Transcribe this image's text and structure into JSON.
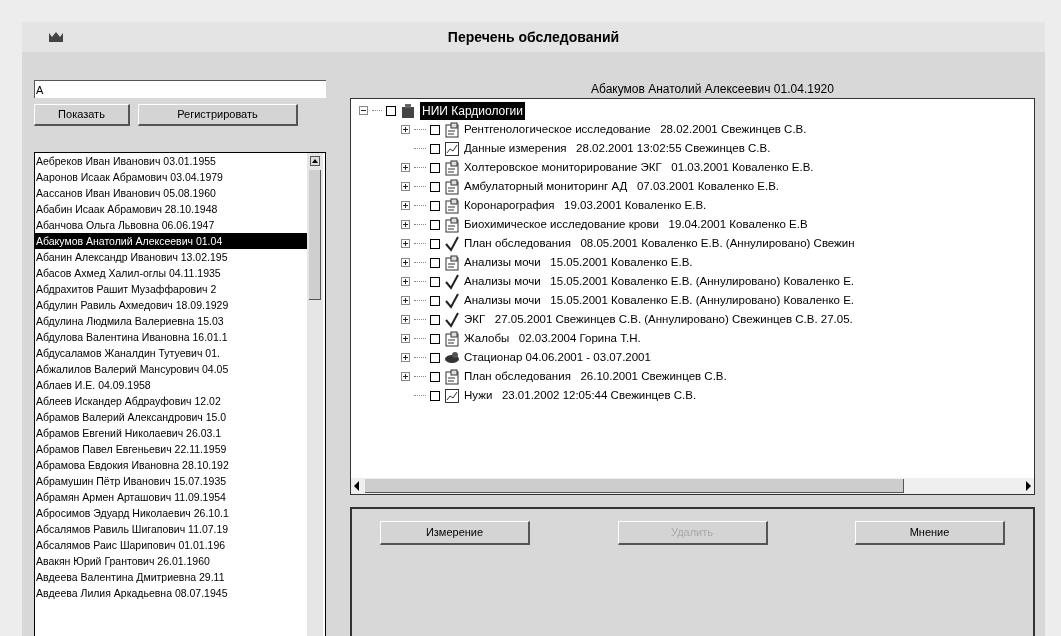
{
  "window": {
    "title": "Перечень обследований"
  },
  "search": {
    "value": "А"
  },
  "actions": [
    {
      "label": "Показать"
    },
    {
      "label": "Регистрировать"
    }
  ],
  "patients": [
    {
      "name": "Аебреков Иван Иванович 03.01.1955",
      "selected": false
    },
    {
      "name": "Ааронов Исаак Абрамович 03.04.1979",
      "selected": false
    },
    {
      "name": "Аассанов Иван Иванович 05.08.1960",
      "selected": false
    },
    {
      "name": "Абабин Исаак Абрамович 28.10.1948",
      "selected": false
    },
    {
      "name": "Абанчова Ольга Львовна 06.06.1947",
      "selected": false
    },
    {
      "name": "Абакумов Анатолий Алексеевич 01.04",
      "selected": true
    },
    {
      "name": "Абанин Александр Иванович 13.02.195",
      "selected": false
    },
    {
      "name": "Абасов Ахмед Халил-оглы 04.11.1935",
      "selected": false
    },
    {
      "name": "Абдрахитов Рашит Музаффарович 2",
      "selected": false
    },
    {
      "name": "Абдулин Равиль Ахмедович 18.09.1929",
      "selected": false
    },
    {
      "name": "Абдулина Людмила Валериевна 15.03",
      "selected": false
    },
    {
      "name": "Абдулова Валентина Ивановна 16.01.1",
      "selected": false
    },
    {
      "name": "Абдусаламов Жаналдин Тутуевич 01.",
      "selected": false
    },
    {
      "name": "Абжалилов Валерий Мансурович 04.05",
      "selected": false
    },
    {
      "name": "Аблаев И.Е. 04.09.1958",
      "selected": false
    },
    {
      "name": "Аблеев Искандер Абдрауфович 12.02",
      "selected": false
    },
    {
      "name": "Абрамов Валерий Александрович 15.0",
      "selected": false
    },
    {
      "name": "Абрамов Евгений Николаевич 26.03.1",
      "selected": false
    },
    {
      "name": "Абрамов Павел Евгеньевич 22.11.1959",
      "selected": false
    },
    {
      "name": "Абрамова Евдокия Ивановна 28.10.192",
      "selected": false
    },
    {
      "name": "Абрамушин Пётр Иванович 15.07.1935",
      "selected": false
    },
    {
      "name": "Абрамян Армен Арташович 11.09.1954",
      "selected": false
    },
    {
      "name": "Абросимов Эдуард Николаевич 26.10.1",
      "selected": false
    },
    {
      "name": "Абсалямов Равиль Шигапович 11.07.19",
      "selected": false
    },
    {
      "name": "Абсалямов Раис Шарипович 01.01.196",
      "selected": false
    },
    {
      "name": "Авакян Юрий Грантович 26.01.1960",
      "selected": false
    },
    {
      "name": "Авдеева Валентина Дмитриевна 29.11",
      "selected": false
    },
    {
      "name": "Авдеева Лилия Аркадьевна 08.07.1945",
      "selected": false
    }
  ],
  "patient_header": "Абакумов Анатолий Алексеевич 01.04.1920",
  "tree": {
    "label": "НИИ Кардиологии",
    "expanded": true,
    "selected": true,
    "checked": false,
    "children": [
      {
        "kind": "report",
        "expandable": true,
        "checked": false,
        "label": "Рентгенологическое исследование   28.02.2001 Свежинцев С.В."
      },
      {
        "kind": "data",
        "expandable": false,
        "checked": false,
        "label": "Данные измерения   28.02.2001 13:02:55 Свежинцев С.В."
      },
      {
        "kind": "report",
        "expandable": true,
        "checked": false,
        "label": "Холтеровское мониторирование ЭКГ   01.03.2001 Коваленко Е.В."
      },
      {
        "kind": "report",
        "expandable": true,
        "checked": false,
        "label": "Амбулаторный мониторинг АД   07.03.2001 Коваленко Е.В."
      },
      {
        "kind": "report",
        "expandable": true,
        "checked": false,
        "label": "Коронарография   19.03.2001 Коваленко Е.В."
      },
      {
        "kind": "report",
        "expandable": true,
        "checked": false,
        "label": "Биохимическое исследование крови   19.04.2001 Коваленко Е.В"
      },
      {
        "kind": "cancelled",
        "expandable": true,
        "checked": false,
        "label": "План обследования   08.05.2001 Коваленко Е.В. (Аннулировано) Свежин"
      },
      {
        "kind": "report",
        "expandable": true,
        "checked": false,
        "label": "Анализы мочи   15.05.2001 Коваленко Е.В."
      },
      {
        "kind": "cancelled",
        "expandable": true,
        "checked": false,
        "label": "Анализы мочи   15.05.2001 Коваленко Е.В. (Аннулировано) Коваленко Е."
      },
      {
        "kind": "cancelled",
        "expandable": true,
        "checked": false,
        "label": "Анализы мочи   15.05.2001 Коваленко Е.В. (Аннулировано) Коваленко Е."
      },
      {
        "kind": "cancelled",
        "expandable": true,
        "checked": false,
        "label": "ЭКГ   27.05.2001 Свежинцев С.В. (Аннулировано) Свежинцев С.В. 27.05."
      },
      {
        "kind": "report",
        "expandable": true,
        "checked": false,
        "label": "Жалобы   02.03.2004 Горина Т.Н."
      },
      {
        "kind": "hospital",
        "expandable": true,
        "checked": false,
        "label": "Стационар 04.06.2001 - 03.07.2001"
      },
      {
        "kind": "report",
        "expandable": true,
        "checked": false,
        "label": "План обследования   26.10.2001 Свежинцев С.В."
      },
      {
        "kind": "data",
        "expandable": false,
        "checked": false,
        "label": "Нужи   23.01.2002 12:05:44 Свежинцев С.В."
      }
    ]
  },
  "buttons": [
    {
      "label": "Измерение",
      "disabled": false
    },
    {
      "label": "Удалить",
      "disabled": true
    },
    {
      "label": "Мнение",
      "disabled": false
    }
  ]
}
